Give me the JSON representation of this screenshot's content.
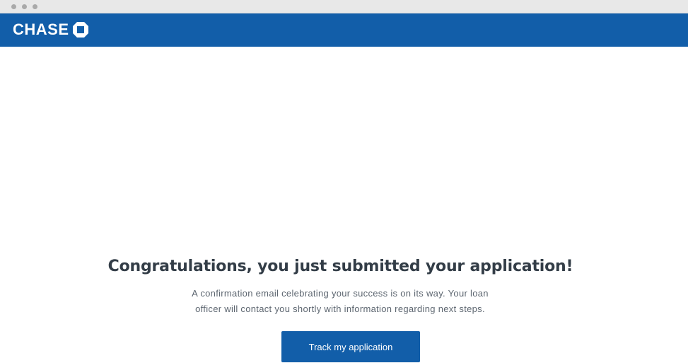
{
  "header": {
    "brand_name": "CHASE",
    "logo_icon": "chase-octagon-logo",
    "brand_color": "#125ea9"
  },
  "confirmation": {
    "headline": "Congratulations, you just submitted your application!",
    "message_line1": "A confirmation email celebrating your success is on its way.  Your loan",
    "message_line2": "officer will contact you shortly with information regarding next steps.",
    "button_label": "Track my application"
  }
}
